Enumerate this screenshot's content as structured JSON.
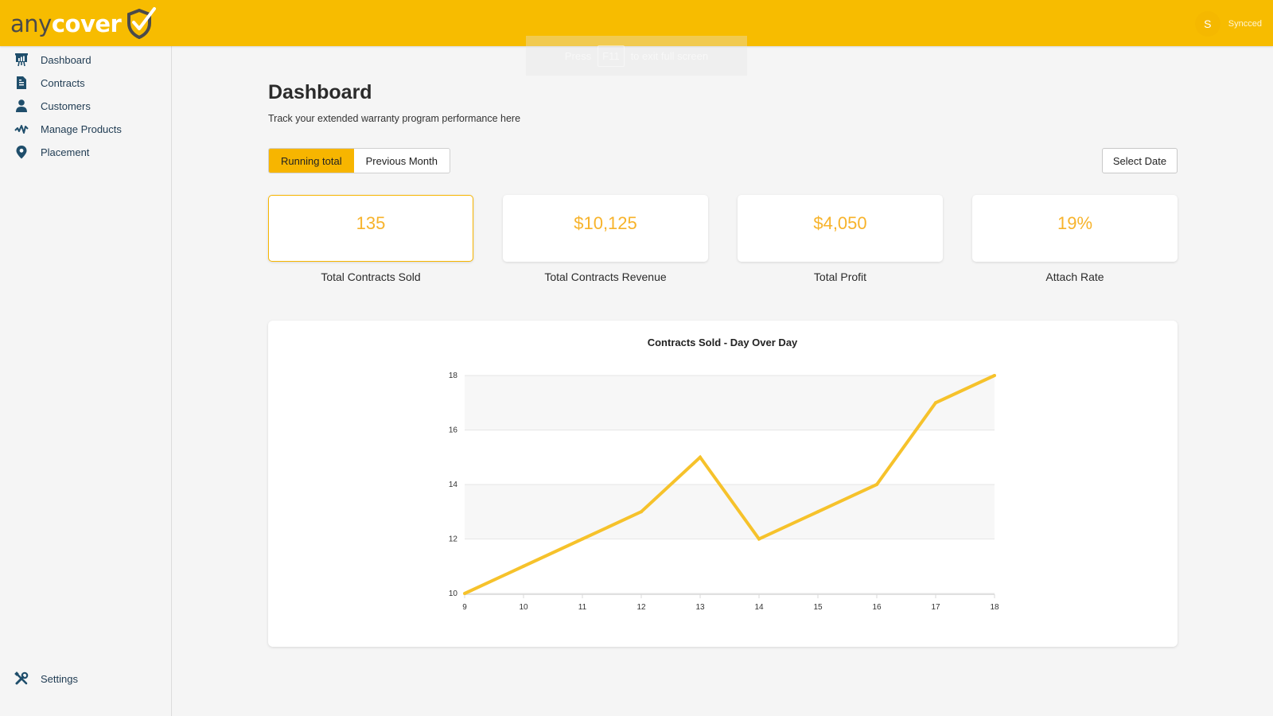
{
  "header": {
    "logo_part1": "any",
    "logo_part2": "cover",
    "avatar_initial": "S",
    "sync_status": "Syncced",
    "brand_color": "#f7bc00"
  },
  "fullscreen_notice": {
    "prefix": "Press",
    "key": "F11",
    "suffix": "to exit full screen"
  },
  "sidebar": {
    "items": [
      {
        "label": "Dashboard",
        "icon": "presentation-chart-icon"
      },
      {
        "label": "Contracts",
        "icon": "document-icon"
      },
      {
        "label": "Customers",
        "icon": "user-icon"
      },
      {
        "label": "Manage Products",
        "icon": "activity-icon"
      },
      {
        "label": "Placement",
        "icon": "map-pin-icon"
      }
    ],
    "bottom_item": {
      "label": "Settings",
      "icon": "tools-icon"
    }
  },
  "page": {
    "title": "Dashboard",
    "subtitle": "Track your extended warranty program performance here",
    "toggle": {
      "options": [
        "Running total",
        "Previous Month"
      ],
      "selected": "Running total"
    },
    "select_date_label": "Select Date"
  },
  "kpis": [
    {
      "value": "135",
      "label": "Total Contracts Sold",
      "active": true
    },
    {
      "value": "$10,125",
      "label": "Total Contracts Revenue",
      "active": false
    },
    {
      "value": "$4,050",
      "label": "Total Profit",
      "active": false
    },
    {
      "value": "19%",
      "label": "Attach Rate",
      "active": false
    }
  ],
  "chart_data": {
    "type": "line",
    "title": "Contracts Sold - Day Over Day",
    "xlabel": "",
    "ylabel": "",
    "x": [
      9,
      10,
      11,
      12,
      13,
      14,
      15,
      16,
      17,
      18
    ],
    "series": [
      {
        "name": "Contracts Sold",
        "values": [
          10,
          11,
          12,
          13,
          15,
          12,
          13,
          14,
          17,
          18
        ],
        "color": "#f6c22b"
      }
    ],
    "xlim": [
      9,
      18
    ],
    "ylim": [
      10,
      18
    ],
    "x_ticks": [
      9,
      10,
      11,
      12,
      13,
      14,
      15,
      16,
      17,
      18
    ],
    "y_ticks": [
      10,
      12,
      14,
      16,
      18
    ],
    "grid": true,
    "alternating_bands": true,
    "legend": "none"
  }
}
